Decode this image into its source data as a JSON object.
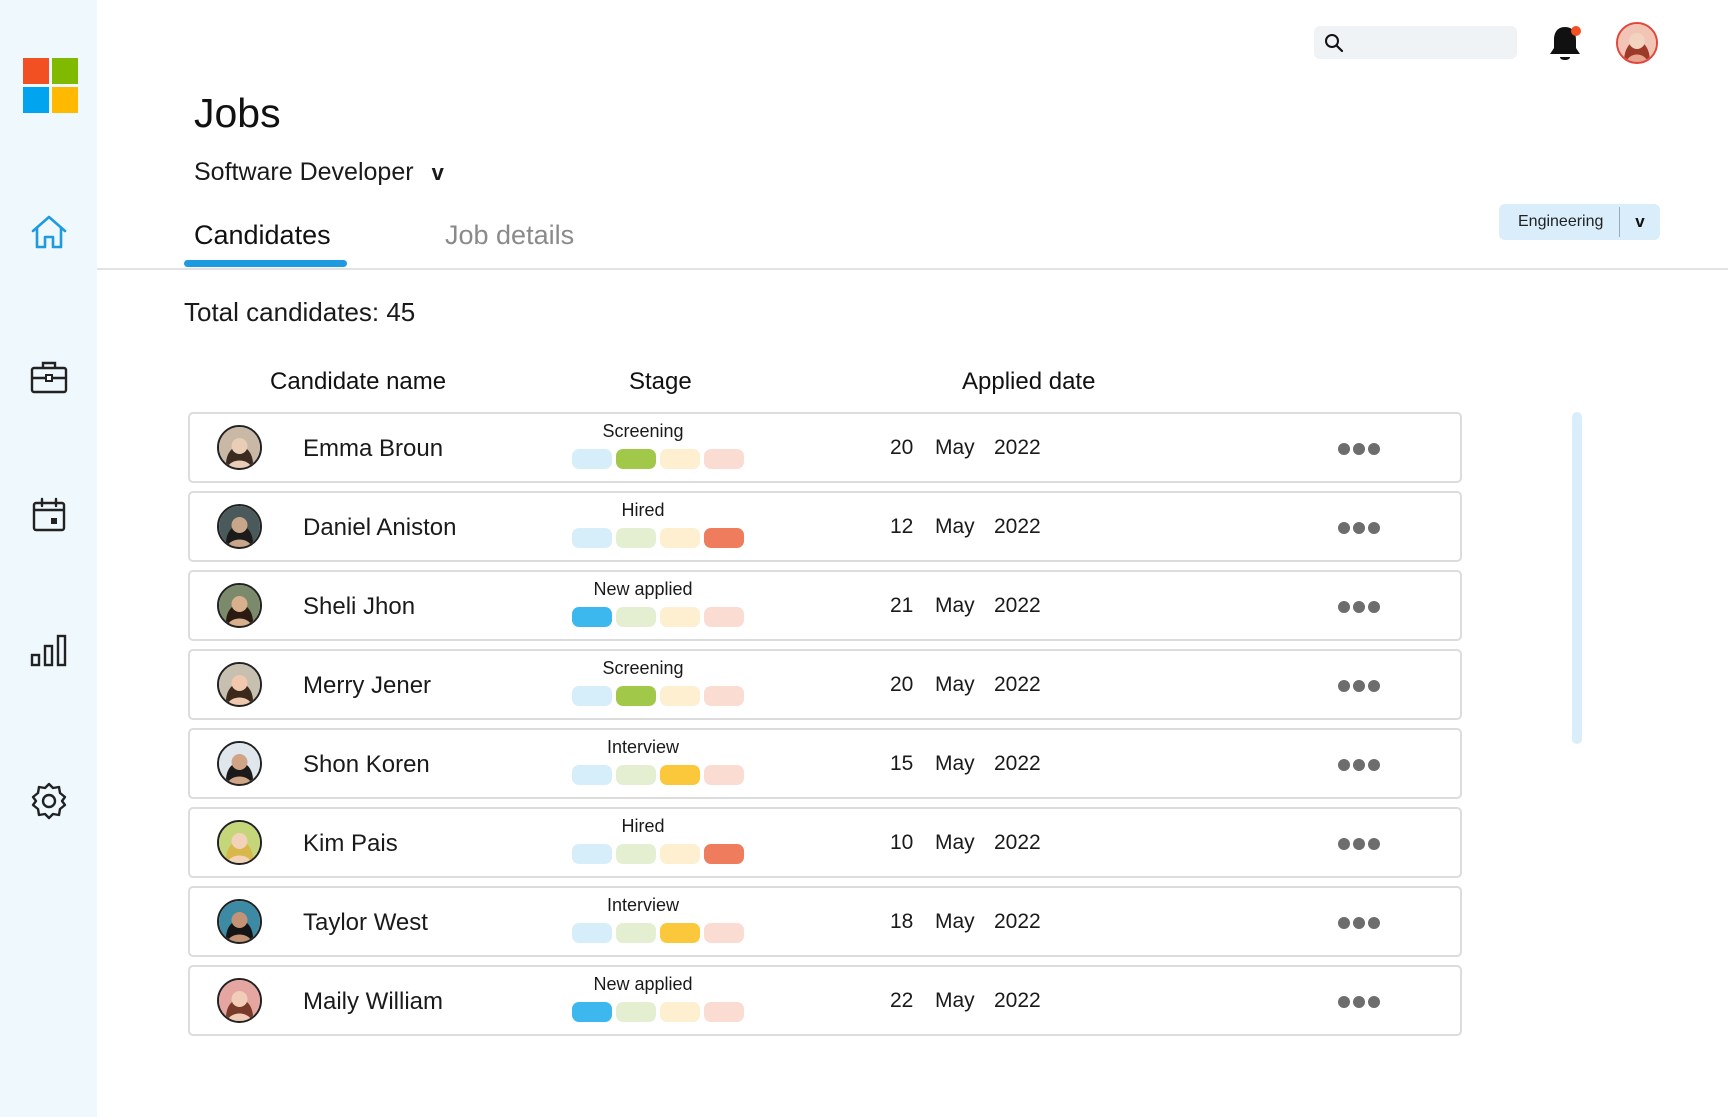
{
  "app": {
    "page_title": "Jobs",
    "job_selected": "Software Developer",
    "job_chevron": "v"
  },
  "colors": {
    "accent": "#1e9ae0",
    "sidebar_bg": "#eef8fd",
    "stage_new_applied": "#3cb8ef",
    "stage_screening": "#a2c84a",
    "stage_interview": "#fbc83c",
    "stage_hired": "#ef7c5c"
  },
  "sidebar": {
    "items": [
      {
        "icon": "home-icon",
        "active": true
      },
      {
        "icon": "briefcase-icon",
        "active": false
      },
      {
        "icon": "calendar-icon",
        "active": false
      },
      {
        "icon": "bar-chart-icon",
        "active": false
      },
      {
        "icon": "settings-icon",
        "active": false
      }
    ]
  },
  "header": {
    "search_placeholder": "",
    "has_notification": true
  },
  "tabs": [
    {
      "label": "Candidates",
      "active": true
    },
    {
      "label": "Job details",
      "active": false
    }
  ],
  "department": {
    "label": "Engineering",
    "chevron": "v"
  },
  "summary": {
    "total_text": "Total candidates: 45"
  },
  "table": {
    "columns": [
      "Candidate name",
      "Stage",
      "Applied date"
    ],
    "stage_order": [
      "New applied",
      "Screening",
      "Interview",
      "Hired"
    ],
    "rows": [
      {
        "name": "Emma Broun",
        "stage": "Screening",
        "stage_index": 1,
        "day": "20",
        "month": "May",
        "year": "2022"
      },
      {
        "name": "Daniel Aniston",
        "stage": "Hired",
        "stage_index": 3,
        "day": "12",
        "month": "May",
        "year": "2022"
      },
      {
        "name": "Sheli Jhon",
        "stage": "New applied",
        "stage_index": 0,
        "day": "21",
        "month": "May",
        "year": "2022"
      },
      {
        "name": "Merry Jener",
        "stage": "Screening",
        "stage_index": 1,
        "day": "20",
        "month": "May",
        "year": "2022"
      },
      {
        "name": "Shon Koren",
        "stage": "Interview",
        "stage_index": 2,
        "day": "15",
        "month": "May",
        "year": "2022"
      },
      {
        "name": "Kim Pais",
        "stage": "Hired",
        "stage_index": 3,
        "day": "10",
        "month": "May",
        "year": "2022"
      },
      {
        "name": "Taylor West",
        "stage": "Interview",
        "stage_index": 2,
        "day": "18",
        "month": "May",
        "year": "2022"
      },
      {
        "name": "Maily William",
        "stage": "New applied",
        "stage_index": 0,
        "day": "22",
        "month": "May",
        "year": "2022"
      }
    ]
  }
}
